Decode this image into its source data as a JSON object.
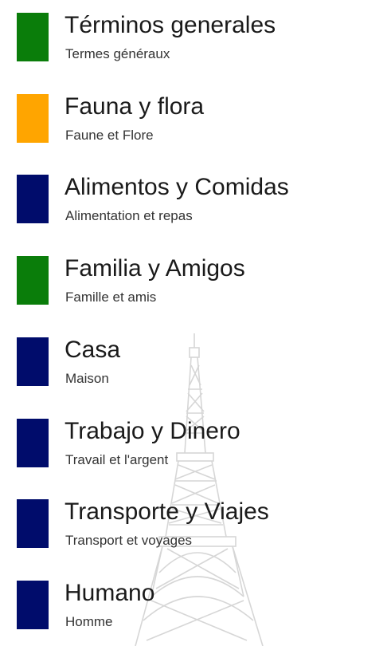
{
  "categories": [
    {
      "title": "Términos generales",
      "subtitle": "Termes généraux",
      "color": "#0a7d0a"
    },
    {
      "title": "Fauna y flora",
      "subtitle": "Faune et Flore",
      "color": "#ffa500"
    },
    {
      "title": "Alimentos y Comidas",
      "subtitle": "Alimentation et repas",
      "color": "#000c6b"
    },
    {
      "title": "Familia y Amigos",
      "subtitle": "Famille et amis",
      "color": "#0a7d0a"
    },
    {
      "title": "Casa",
      "subtitle": "Maison",
      "color": "#000c6b"
    },
    {
      "title": "Trabajo y Dinero",
      "subtitle": "Travail et l'argent",
      "color": "#000c6b"
    },
    {
      "title": "Transporte y Viajes",
      "subtitle": "Transport et voyages",
      "color": "#000c6b"
    },
    {
      "title": "Humano",
      "subtitle": "Homme",
      "color": "#000c6b"
    }
  ],
  "background_image": "eiffel-tower-watermark"
}
